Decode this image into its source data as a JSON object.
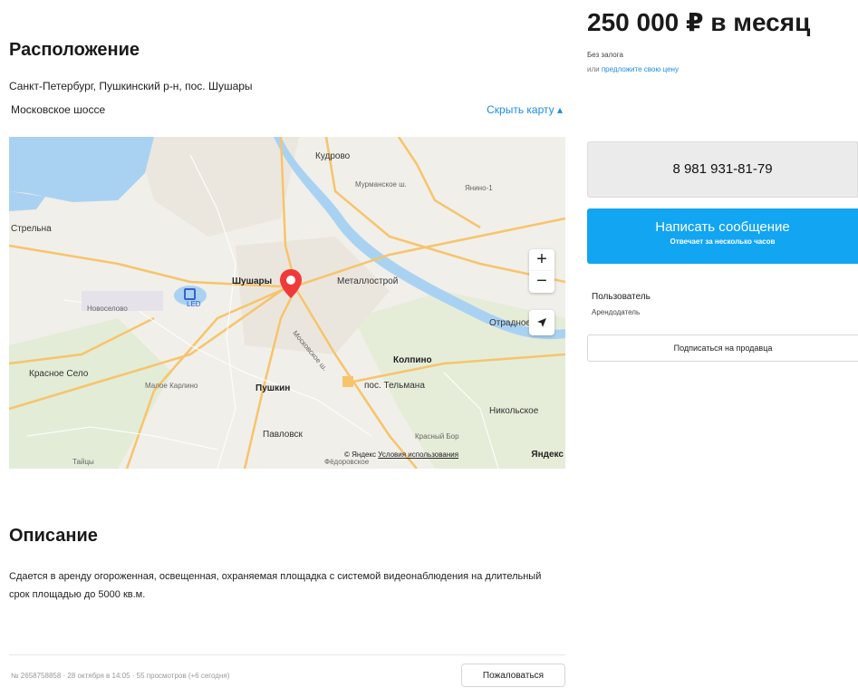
{
  "location": {
    "title": "Расположение",
    "address_line1": "Санкт-Петербург, Пушкинский р-н, пос. Шушары",
    "address_line2": "Московское шоссе",
    "hide_map_label": "Скрыть карту ▴"
  },
  "map": {
    "labels": {
      "kudrovo": "Кудрово",
      "kudrovo_sub": "Мурманское ш.",
      "kantse": "Янино-1",
      "strelna": "Стрельна",
      "shushary": "Шушары",
      "metallostroy": "Металлострой",
      "otradnoe": "Отрадное",
      "kolpino": "Колпино",
      "pos_telmana": "пос. Тельмана",
      "nikolskoe": "Никольское",
      "krasnoe_selo": "Красное Село",
      "pushkin": "Пушкин",
      "pavlovsk": "Павловск",
      "malye_kuzmino": "Малое Карлино",
      "novoselovo": "Новоселово",
      "led": "LED",
      "taitsy": "Тайцы",
      "krasny_bor": "Красный Бор",
      "federalnoe": "Фёдоровское",
      "moskovskoe": "Московское ш."
    },
    "zoom_in": "+",
    "zoom_out": "−",
    "copyright_prefix": "© Яндекс",
    "terms": "Условия использования",
    "logo": "Яндекс",
    "marker_color": "#f03a3a",
    "water_color": "#a9d2f2",
    "road_color": "#f7c46c"
  },
  "description": {
    "title": "Описание",
    "text": "Сдается в аренду огороженная, освещенная, охраняемая площадка с системой видеонаблюдения на длительный срок площадью до 5000 кв.м."
  },
  "footer": {
    "meta": "№ 2658758858 · 28 октября в 14:05 · 55 просмотров (+6 сегодня)",
    "complain_label": "Пожаловаться"
  },
  "sidebar": {
    "price": "250 000 ₽ в месяц",
    "deposit": "Без залога",
    "offer_prefix": "или",
    "offer_link": "предложите свою цену",
    "phone": "8 981 931-81-79",
    "message_label": "Написать сообщение",
    "message_sub": "Отвечает за несколько часов",
    "seller_name": "Пользователь",
    "seller_role": "Арендодатель",
    "subscribe_label": "Подписаться на продавца",
    "accent_color": "#11a5f2"
  }
}
